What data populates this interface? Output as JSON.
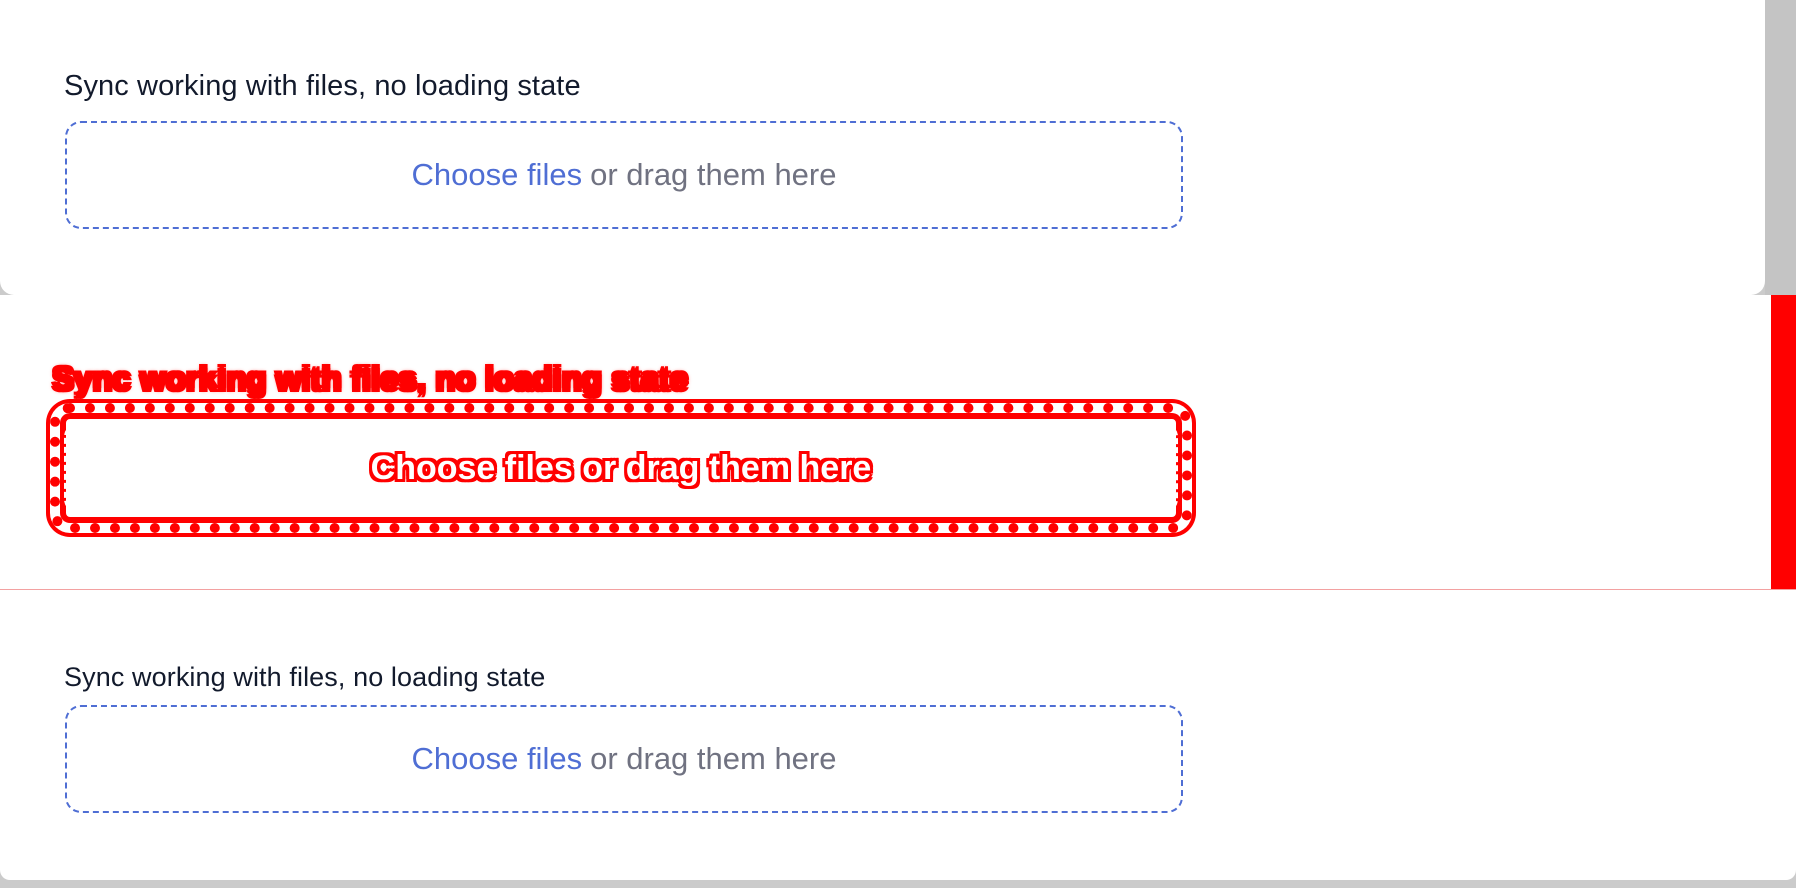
{
  "top_panel": {
    "label": "Sync working with files, no loading state",
    "dropzone": {
      "link_text": "Choose files",
      "rest_text": "or drag them here"
    }
  },
  "diff_panel": {
    "label": "Sync working with files, no loading state",
    "dropzone": {
      "link_text": "Choose files",
      "rest_text": "or drag them here"
    },
    "highlight_color": "#ff0000"
  },
  "bottom_panel": {
    "label": "Sync working with files, no loading state",
    "dropzone": {
      "link_text": "Choose files",
      "rest_text": "or drag them here"
    }
  },
  "colors": {
    "accent": "#4f6ed4",
    "text": "#121a2c",
    "muted": "#707281",
    "diff": "#ff0000"
  }
}
